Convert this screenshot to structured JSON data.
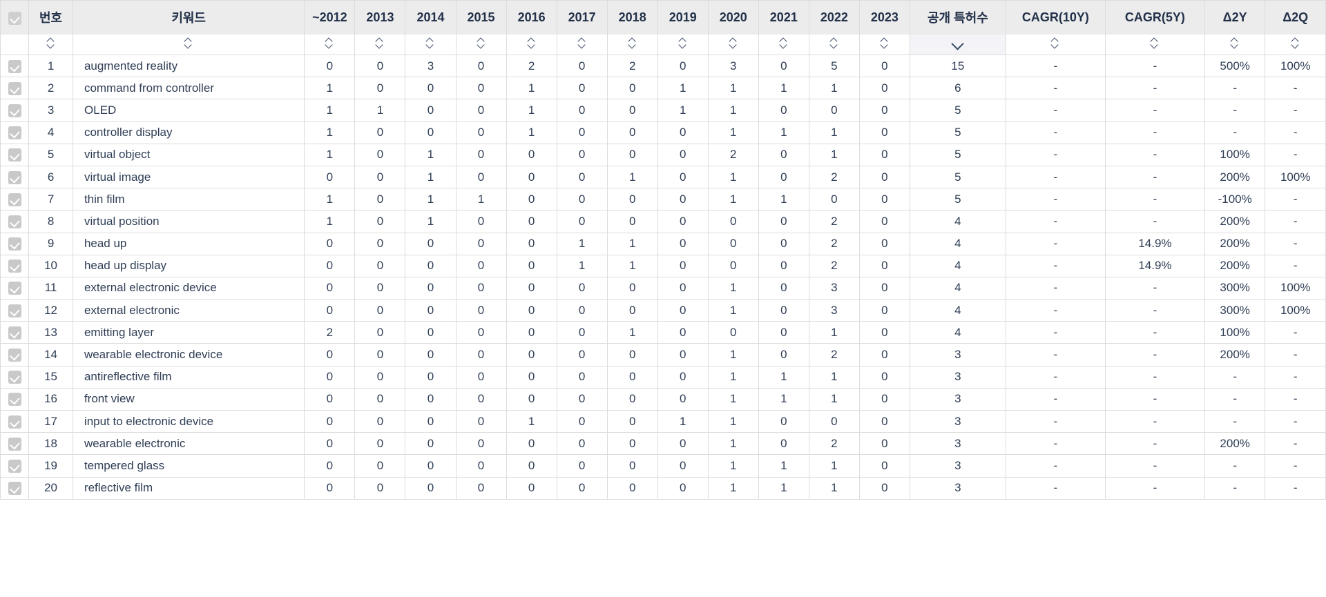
{
  "table": {
    "columns": {
      "select_all": "select-all-checkbox",
      "number": "번호",
      "keyword": "키워드",
      "years": [
        "~2012",
        "2013",
        "2014",
        "2015",
        "2016",
        "2017",
        "2018",
        "2019",
        "2020",
        "2021",
        "2022",
        "2023"
      ],
      "total": "공개 특허수",
      "cagr10": "CAGR(10Y)",
      "cagr5": "CAGR(5Y)",
      "delta2y": "Δ2Y",
      "delta2q": "Δ2Q"
    },
    "sort": {
      "active_column": "공개 특허수",
      "direction": "desc",
      "icon_default": "sort-updown-icon",
      "icon_active": "chevron-down-icon"
    },
    "rows": [
      {
        "no": "1",
        "keyword": "augmented reality",
        "years": [
          "0",
          "0",
          "3",
          "0",
          "2",
          "0",
          "2",
          "0",
          "3",
          "0",
          "5",
          "0"
        ],
        "total": "15",
        "cagr10": "-",
        "cagr5": "-",
        "d2y": "500%",
        "d2q": "100%"
      },
      {
        "no": "2",
        "keyword": "command from controller",
        "years": [
          "1",
          "0",
          "0",
          "0",
          "1",
          "0",
          "0",
          "1",
          "1",
          "1",
          "1",
          "0"
        ],
        "total": "6",
        "cagr10": "-",
        "cagr5": "-",
        "d2y": "-",
        "d2q": "-"
      },
      {
        "no": "3",
        "keyword": "OLED",
        "years": [
          "1",
          "1",
          "0",
          "0",
          "1",
          "0",
          "0",
          "1",
          "1",
          "0",
          "0",
          "0"
        ],
        "total": "5",
        "cagr10": "-",
        "cagr5": "-",
        "d2y": "-",
        "d2q": "-"
      },
      {
        "no": "4",
        "keyword": "controller display",
        "years": [
          "1",
          "0",
          "0",
          "0",
          "1",
          "0",
          "0",
          "0",
          "1",
          "1",
          "1",
          "0"
        ],
        "total": "5",
        "cagr10": "-",
        "cagr5": "-",
        "d2y": "-",
        "d2q": "-"
      },
      {
        "no": "5",
        "keyword": "virtual object",
        "years": [
          "1",
          "0",
          "1",
          "0",
          "0",
          "0",
          "0",
          "0",
          "2",
          "0",
          "1",
          "0"
        ],
        "total": "5",
        "cagr10": "-",
        "cagr5": "-",
        "d2y": "100%",
        "d2q": "-"
      },
      {
        "no": "6",
        "keyword": "virtual image",
        "years": [
          "0",
          "0",
          "1",
          "0",
          "0",
          "0",
          "1",
          "0",
          "1",
          "0",
          "2",
          "0"
        ],
        "total": "5",
        "cagr10": "-",
        "cagr5": "-",
        "d2y": "200%",
        "d2q": "100%"
      },
      {
        "no": "7",
        "keyword": "thin film",
        "years": [
          "1",
          "0",
          "1",
          "1",
          "0",
          "0",
          "0",
          "0",
          "1",
          "1",
          "0",
          "0"
        ],
        "total": "5",
        "cagr10": "-",
        "cagr5": "-",
        "d2y": "-100%",
        "d2q": "-"
      },
      {
        "no": "8",
        "keyword": "virtual position",
        "years": [
          "1",
          "0",
          "1",
          "0",
          "0",
          "0",
          "0",
          "0",
          "0",
          "0",
          "2",
          "0"
        ],
        "total": "4",
        "cagr10": "-",
        "cagr5": "-",
        "d2y": "200%",
        "d2q": "-"
      },
      {
        "no": "9",
        "keyword": "head up",
        "years": [
          "0",
          "0",
          "0",
          "0",
          "0",
          "1",
          "1",
          "0",
          "0",
          "0",
          "2",
          "0"
        ],
        "total": "4",
        "cagr10": "-",
        "cagr5": "14.9%",
        "d2y": "200%",
        "d2q": "-"
      },
      {
        "no": "10",
        "keyword": "head up display",
        "years": [
          "0",
          "0",
          "0",
          "0",
          "0",
          "1",
          "1",
          "0",
          "0",
          "0",
          "2",
          "0"
        ],
        "total": "4",
        "cagr10": "-",
        "cagr5": "14.9%",
        "d2y": "200%",
        "d2q": "-"
      },
      {
        "no": "11",
        "keyword": "external electronic device",
        "years": [
          "0",
          "0",
          "0",
          "0",
          "0",
          "0",
          "0",
          "0",
          "1",
          "0",
          "3",
          "0"
        ],
        "total": "4",
        "cagr10": "-",
        "cagr5": "-",
        "d2y": "300%",
        "d2q": "100%"
      },
      {
        "no": "12",
        "keyword": "external electronic",
        "years": [
          "0",
          "0",
          "0",
          "0",
          "0",
          "0",
          "0",
          "0",
          "1",
          "0",
          "3",
          "0"
        ],
        "total": "4",
        "cagr10": "-",
        "cagr5": "-",
        "d2y": "300%",
        "d2q": "100%"
      },
      {
        "no": "13",
        "keyword": "emitting layer",
        "years": [
          "2",
          "0",
          "0",
          "0",
          "0",
          "0",
          "1",
          "0",
          "0",
          "0",
          "1",
          "0"
        ],
        "total": "4",
        "cagr10": "-",
        "cagr5": "-",
        "d2y": "100%",
        "d2q": "-"
      },
      {
        "no": "14",
        "keyword": "wearable electronic device",
        "years": [
          "0",
          "0",
          "0",
          "0",
          "0",
          "0",
          "0",
          "0",
          "1",
          "0",
          "2",
          "0"
        ],
        "total": "3",
        "cagr10": "-",
        "cagr5": "-",
        "d2y": "200%",
        "d2q": "-"
      },
      {
        "no": "15",
        "keyword": "antireflective film",
        "years": [
          "0",
          "0",
          "0",
          "0",
          "0",
          "0",
          "0",
          "0",
          "1",
          "1",
          "1",
          "0"
        ],
        "total": "3",
        "cagr10": "-",
        "cagr5": "-",
        "d2y": "-",
        "d2q": "-"
      },
      {
        "no": "16",
        "keyword": "front view",
        "years": [
          "0",
          "0",
          "0",
          "0",
          "0",
          "0",
          "0",
          "0",
          "1",
          "1",
          "1",
          "0"
        ],
        "total": "3",
        "cagr10": "-",
        "cagr5": "-",
        "d2y": "-",
        "d2q": "-"
      },
      {
        "no": "17",
        "keyword": "input to electronic device",
        "years": [
          "0",
          "0",
          "0",
          "0",
          "1",
          "0",
          "0",
          "1",
          "1",
          "0",
          "0",
          "0"
        ],
        "total": "3",
        "cagr10": "-",
        "cagr5": "-",
        "d2y": "-",
        "d2q": "-"
      },
      {
        "no": "18",
        "keyword": "wearable electronic",
        "years": [
          "0",
          "0",
          "0",
          "0",
          "0",
          "0",
          "0",
          "0",
          "1",
          "0",
          "2",
          "0"
        ],
        "total": "3",
        "cagr10": "-",
        "cagr5": "-",
        "d2y": "200%",
        "d2q": "-"
      },
      {
        "no": "19",
        "keyword": "tempered glass",
        "years": [
          "0",
          "0",
          "0",
          "0",
          "0",
          "0",
          "0",
          "0",
          "1",
          "1",
          "1",
          "0"
        ],
        "total": "3",
        "cagr10": "-",
        "cagr5": "-",
        "d2y": "-",
        "d2q": "-"
      },
      {
        "no": "20",
        "keyword": "reflective film",
        "years": [
          "0",
          "0",
          "0",
          "0",
          "0",
          "0",
          "0",
          "0",
          "1",
          "1",
          "1",
          "0"
        ],
        "total": "3",
        "cagr10": "-",
        "cagr5": "-",
        "d2y": "-",
        "d2q": "-"
      }
    ]
  },
  "colors": {
    "header_bg": "#ececec",
    "sorted_bg": "#f3f3f8",
    "text": "#2f3e55",
    "border": "#dcdcdc",
    "checkbox": "#c9c9c9"
  }
}
